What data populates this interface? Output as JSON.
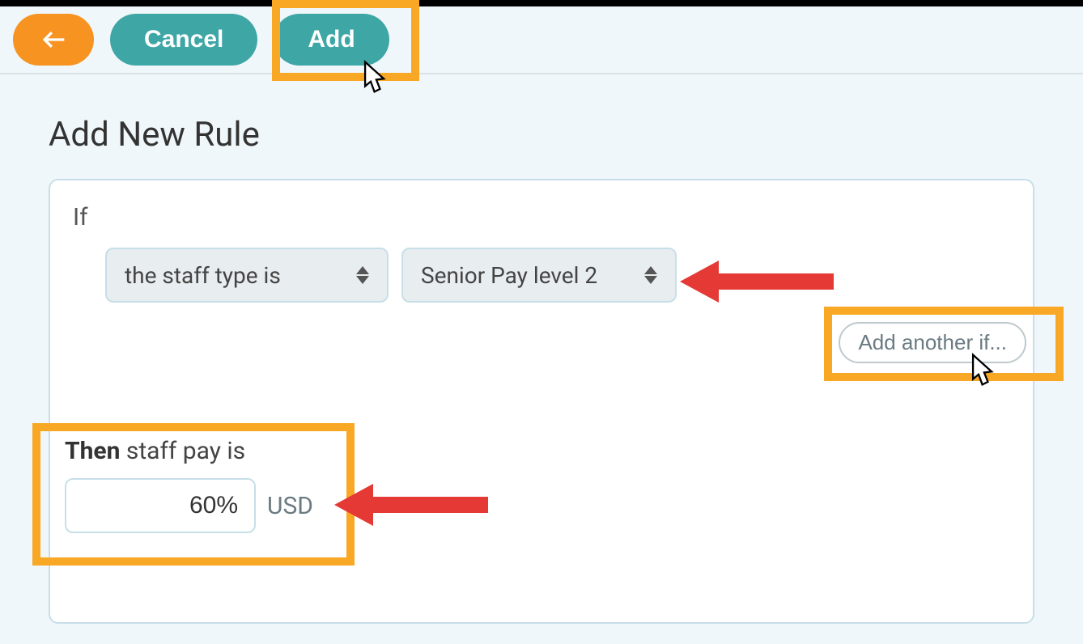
{
  "toolbar": {
    "cancel_label": "Cancel",
    "add_label": "Add"
  },
  "page": {
    "title": "Add New Rule"
  },
  "rule": {
    "if_label": "If",
    "condition_field": "the staff type is",
    "condition_value": "Senior Pay level 2",
    "add_another_label": "Add another if...",
    "then_label": "Then",
    "then_text": "staff pay is",
    "pay_value": "60%",
    "currency": "USD"
  }
}
